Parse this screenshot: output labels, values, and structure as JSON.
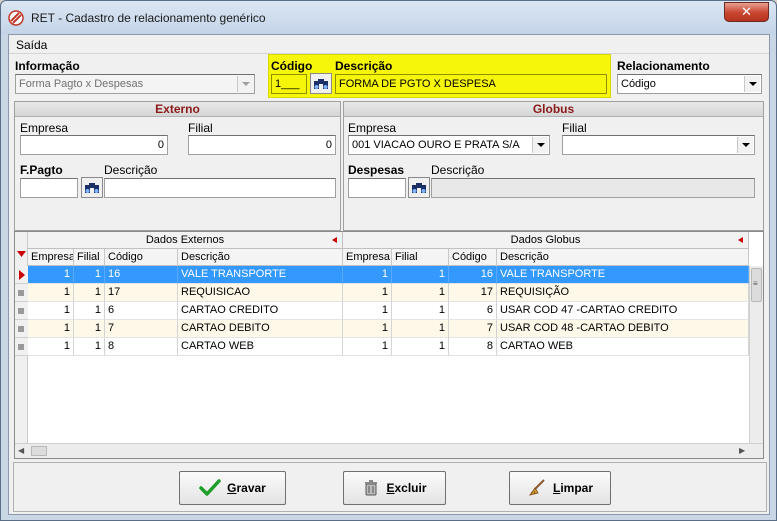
{
  "window": {
    "title": "RET - Cadastro de relacionamento genérico",
    "close_glyph": "✕"
  },
  "menu": {
    "items": [
      "Saída"
    ]
  },
  "top": {
    "informacao": {
      "label": "Informação",
      "value": "Forma Pagto x Despesas"
    },
    "codigo": {
      "label": "Código",
      "value": "1___"
    },
    "descricao": {
      "label": "Descrição",
      "value": "FORMA DE PGTO X DESPESA"
    },
    "relacionamento": {
      "label": "Relacionamento",
      "value": "Código"
    }
  },
  "externo": {
    "title": "Externo",
    "empresa": {
      "label": "Empresa",
      "value": "0"
    },
    "filial": {
      "label": "Filial",
      "value": "0"
    },
    "fpagto": {
      "label": "F.Pagto",
      "value": ""
    },
    "descricao": {
      "label": "Descrição",
      "value": ""
    }
  },
  "globus": {
    "title": "Globus",
    "empresa": {
      "label": "Empresa",
      "value": "001 VIACAO OURO E PRATA S/A"
    },
    "filial": {
      "label": "Filial",
      "value": ""
    },
    "despesas": {
      "label": "Despesas",
      "value": ""
    },
    "descricao": {
      "label": "Descrição",
      "value": ""
    }
  },
  "grid": {
    "band_left": "Dados Externos",
    "band_right": "Dados Globus",
    "columns": [
      "Empresa",
      "Filial",
      "Código",
      "Descrição",
      "Empresa",
      "Filial",
      "Código",
      "Descrição"
    ],
    "rows": [
      {
        "ext_empresa": "1",
        "ext_filial": "1",
        "ext_codigo": "16",
        "ext_desc": "VALE TRANSPORTE",
        "glb_empresa": "1",
        "glb_filial": "1",
        "glb_codigo": "16",
        "glb_desc": "VALE TRANSPORTE",
        "selected": true
      },
      {
        "ext_empresa": "1",
        "ext_filial": "1",
        "ext_codigo": "17",
        "ext_desc": "REQUISICAO",
        "glb_empresa": "1",
        "glb_filial": "1",
        "glb_codigo": "17",
        "glb_desc": "REQUISIÇÃO",
        "selected": false
      },
      {
        "ext_empresa": "1",
        "ext_filial": "1",
        "ext_codigo": "6",
        "ext_desc": "CARTAO CREDITO",
        "glb_empresa": "1",
        "glb_filial": "1",
        "glb_codigo": "6",
        "glb_desc": "USAR COD 47 -CARTAO CREDITO",
        "selected": false
      },
      {
        "ext_empresa": "1",
        "ext_filial": "1",
        "ext_codigo": "7",
        "ext_desc": "CARTAO DEBITO",
        "glb_empresa": "1",
        "glb_filial": "1",
        "glb_codigo": "7",
        "glb_desc": "USAR COD 48 -CARTAO DEBITO",
        "selected": false
      },
      {
        "ext_empresa": "1",
        "ext_filial": "1",
        "ext_codigo": "8",
        "ext_desc": "CARTAO WEB",
        "glb_empresa": "1",
        "glb_filial": "1",
        "glb_codigo": "8",
        "glb_desc": "CARTAO WEB",
        "selected": false
      }
    ]
  },
  "buttons": {
    "gravar": {
      "accel": "G",
      "rest": "ravar"
    },
    "excluir": {
      "accel": "E",
      "rest": "xcluir"
    },
    "limpar": {
      "accel": "L",
      "rest": "impar"
    }
  },
  "colors": {
    "highlight": "#f6f60a",
    "selected_row": "#3399ff",
    "alt_row": "#fdf8e8",
    "panel_title": "#8b1a1a"
  },
  "icons": {
    "app": "app-logo-icon",
    "search": "binoculars-icon",
    "gravar": "checkmark-icon",
    "excluir": "trash-icon",
    "limpar": "broom-icon"
  }
}
